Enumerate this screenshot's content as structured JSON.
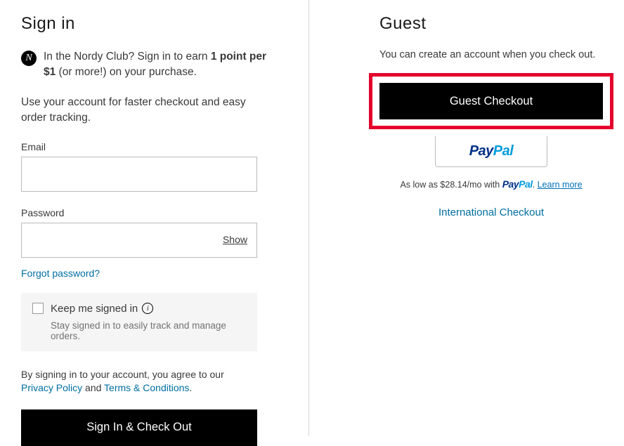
{
  "signin": {
    "heading": "Sign in",
    "nordy_prefix": "In the Nordy Club? Sign in to earn ",
    "nordy_bold": "1 point per $1",
    "nordy_suffix": " (or more!) on your purchase.",
    "subcopy": "Use your account for faster checkout and easy order tracking.",
    "email_label": "Email",
    "password_label": "Password",
    "show_label": "Show",
    "forgot_label": "Forgot password?",
    "keep_label": "Keep me signed in",
    "keep_sub": "Stay signed in to easily track and manage orders.",
    "consent_prefix": "By signing in to your account, you agree to our ",
    "privacy_label": "Privacy Policy",
    "consent_and": " and ",
    "terms_label": "Terms & Conditions",
    "consent_end": ".",
    "submit_label": "Sign In & Check Out"
  },
  "guest": {
    "heading": "Guest",
    "subcopy": "You can create an account when you check out.",
    "button_label": "Guest Checkout",
    "aslowas_prefix": "As low as ",
    "aslowas_amount": "$28.14/mo",
    "aslowas_with": " with ",
    "learn_more": "Learn more",
    "intl_label": "International Checkout"
  },
  "paypal": {
    "pay": "Pay",
    "pal": "Pal",
    "period": "."
  },
  "highlight_color": "#e4002b"
}
